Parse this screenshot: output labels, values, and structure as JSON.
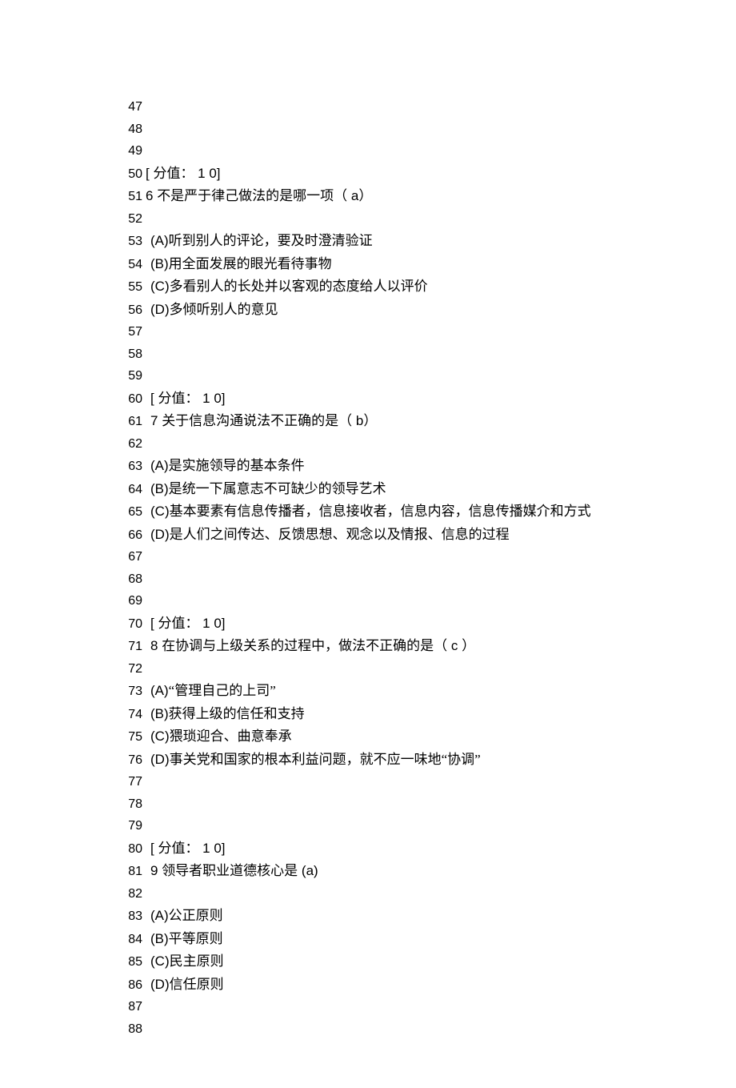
{
  "lines": [
    {
      "n": "47",
      "t": ""
    },
    {
      "n": "48",
      "t": ""
    },
    {
      "n": "49",
      "t": ""
    },
    {
      "n": "50",
      "t": "[ 分值：   1 0]",
      "nogap": true
    },
    {
      "n": "51",
      "t": "6 不是严于律己做法的是哪一项（ a）",
      "nogap": true
    },
    {
      "n": "52",
      "t": ""
    },
    {
      "n": "53",
      "t": "(A)听到别人的评论，要及时澄清验证"
    },
    {
      "n": "54",
      "t": "(B)用全面发展的眼光看待事物"
    },
    {
      "n": "55",
      "t": "(C)多看别人的长处并以客观的态度给人以评价"
    },
    {
      "n": "56",
      "t": "(D)多倾听别人的意见"
    },
    {
      "n": "57",
      "t": ""
    },
    {
      "n": "58",
      "t": ""
    },
    {
      "n": "59",
      "t": ""
    },
    {
      "n": "60",
      "t": "[ 分值：   1 0]"
    },
    {
      "n": "61",
      "t": "7 关于信息沟通说法不正确的是（ b）"
    },
    {
      "n": "62",
      "t": ""
    },
    {
      "n": "63",
      "t": "(A)是实施领导的基本条件"
    },
    {
      "n": "64",
      "t": "(B)是统一下属意志不可缺少的领导艺术"
    },
    {
      "n": "65",
      "t": "(C)基本要素有信息传播者，信息接收者，信息内容，信息传播媒介和方式"
    },
    {
      "n": "66",
      "t": "(D)是人们之间传达、反馈思想、观念以及情报、信息的过程"
    },
    {
      "n": "67",
      "t": ""
    },
    {
      "n": "68",
      "t": ""
    },
    {
      "n": "69",
      "t": ""
    },
    {
      "n": "70",
      "t": "[ 分值：   1 0]"
    },
    {
      "n": "71",
      "t": "8 在协调与上级关系的过程中，做法不正确的是（ c ）"
    },
    {
      "n": "72",
      "t": ""
    },
    {
      "n": "73",
      "t": "(A)“管理自己的上司”"
    },
    {
      "n": "74",
      "t": "(B)获得上级的信任和支持"
    },
    {
      "n": "75",
      "t": "(C)猥琐迎合、曲意奉承"
    },
    {
      "n": "76",
      "t": "(D)事关党和国家的根本利益问题，就不应一味地“协调”"
    },
    {
      "n": "77",
      "t": ""
    },
    {
      "n": "78",
      "t": ""
    },
    {
      "n": "79",
      "t": ""
    },
    {
      "n": "80",
      "t": "[ 分值：   1 0]"
    },
    {
      "n": "81",
      "t": "9 领导者职业道德核心是 (a)"
    },
    {
      "n": "82",
      "t": ""
    },
    {
      "n": "83",
      "t": "(A)公正原则"
    },
    {
      "n": "84",
      "t": "(B)平等原则"
    },
    {
      "n": "85",
      "t": "(C)民主原则"
    },
    {
      "n": "86",
      "t": "(D)信任原则"
    },
    {
      "n": "87",
      "t": ""
    },
    {
      "n": "88",
      "t": ""
    }
  ]
}
